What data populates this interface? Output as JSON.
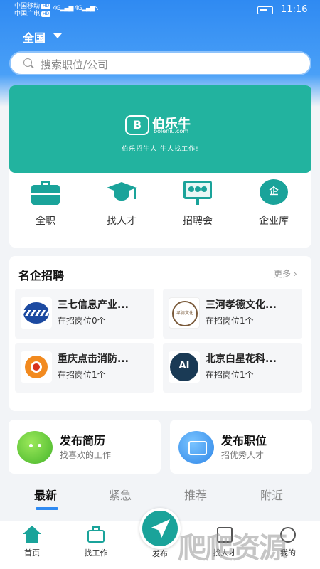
{
  "status_bar": {
    "carrier1": "中国移动",
    "carrier2": "中国广电",
    "hd_badge": "HD",
    "signal1": "4G",
    "signal2": "4G",
    "time": "11:16"
  },
  "header": {
    "region": "全国",
    "search_placeholder": "搜索职位/公司"
  },
  "banner": {
    "logo_badge": "B",
    "logo_name": "伯乐牛",
    "logo_url": "boleniu.com",
    "slogan": "伯乐招牛人 牛人找工作!"
  },
  "categories": [
    {
      "label": "全职",
      "icon": "briefcase-icon"
    },
    {
      "label": "找人才",
      "icon": "graduation-cap-icon"
    },
    {
      "label": "招聘会",
      "icon": "job-fair-icon"
    },
    {
      "label": "企业库",
      "icon": "company-library-icon",
      "glyph": "企"
    }
  ],
  "famous": {
    "title": "名企招聘",
    "more": "更多 ›",
    "companies": [
      {
        "name": "三七信息产业...",
        "count": "在招岗位0个"
      },
      {
        "name": "三河孝德文化...",
        "count": "在招岗位1个",
        "logo_text": "孝德文化"
      },
      {
        "name": "重庆点击消防...",
        "count": "在招岗位1个"
      },
      {
        "name": "北京白星花科...",
        "count": "在招岗位1个",
        "logo_text": "AI"
      }
    ]
  },
  "publish": [
    {
      "title": "发布简历",
      "subtitle": "找喜欢的工作"
    },
    {
      "title": "发布职位",
      "subtitle": "招优秀人才"
    }
  ],
  "tabs": [
    "最新",
    "紧急",
    "推荐",
    "附近"
  ],
  "nav": {
    "items": [
      "首页",
      "找工作",
      "发布",
      "找人才",
      "我的"
    ]
  },
  "watermark": "爬爬资源",
  "colors": {
    "primary": "#2f8af2",
    "teal": "#1aa39a",
    "banner": "#22b39f"
  }
}
